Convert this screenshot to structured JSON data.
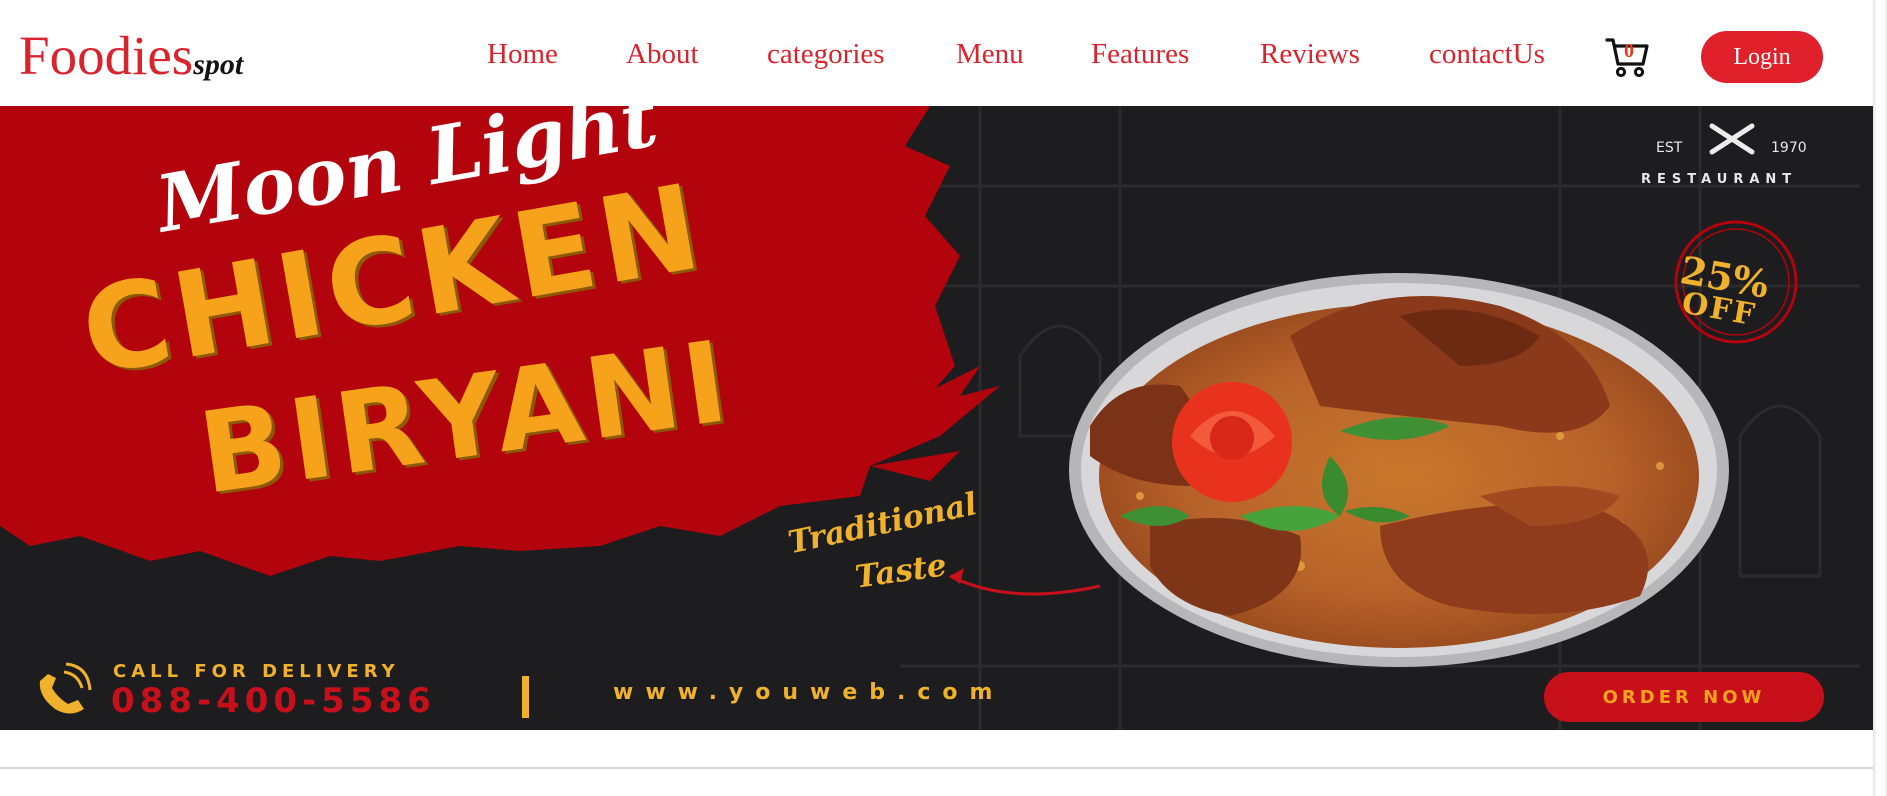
{
  "brand": {
    "main": "Foodies",
    "sub": "spot"
  },
  "nav": {
    "items": [
      {
        "label": "Home"
      },
      {
        "label": "About"
      },
      {
        "label": "categories"
      },
      {
        "label": "Menu"
      },
      {
        "label": "Features"
      },
      {
        "label": "Reviews"
      },
      {
        "label": "contactUs"
      }
    ]
  },
  "cart": {
    "count": "0",
    "icon": "cart-icon"
  },
  "login": {
    "label": "Login"
  },
  "hero": {
    "est_left": "EST",
    "est_right": "1970",
    "est_name": "RESTAURANT",
    "line1": "Moon Light",
    "line2": "CHICKEN",
    "line3": "BIRYANI",
    "tagline1": "Traditional",
    "tagline2": "Taste",
    "discount": "25%",
    "discount_word": "OFF",
    "call_label": "CALL FOR DELIVERY",
    "phone": "088-400-5586",
    "website": "www.youweb.com",
    "order_button": "ORDER NOW"
  },
  "colors": {
    "brand_red": "#d9232d",
    "banner_red": "#c8101b",
    "banner_gold": "#f7a21b",
    "banner_dark": "#1d1d1f"
  }
}
